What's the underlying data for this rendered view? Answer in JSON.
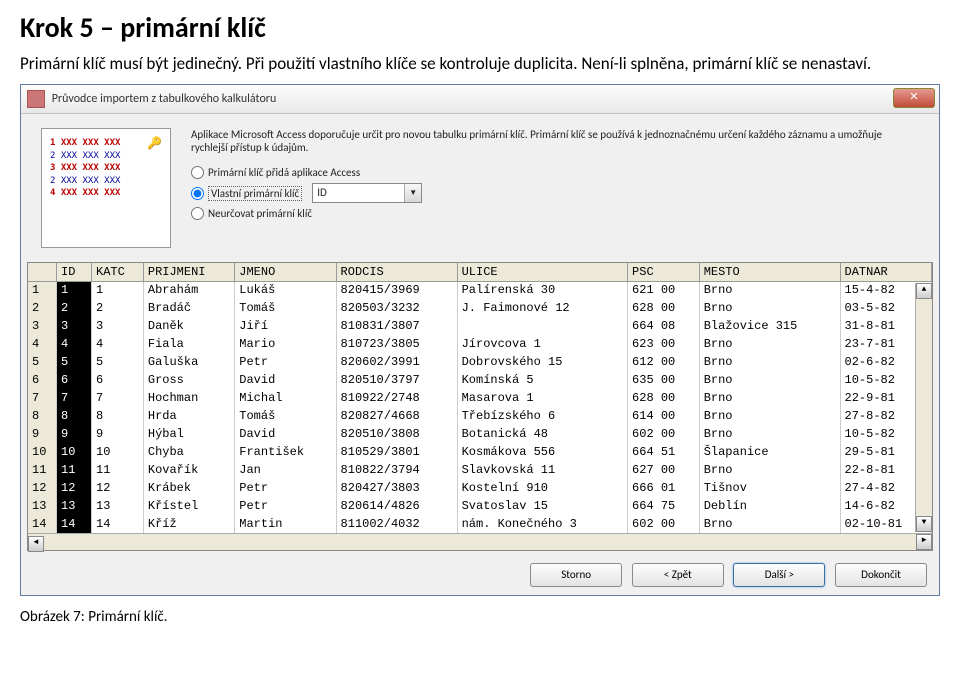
{
  "heading": "Krok 5 – primární klíč",
  "intro": "Primární klíč musí být jedinečný. Při použití vlastního klíče se kontroluje duplicita. Není-li splněna, primární klíč se nenastaví.",
  "caption": "Obrázek 7: Primární klíč.",
  "window": {
    "title": "Průvodce importem z tabulkového kalkulátoru",
    "close": "✕",
    "description": "Aplikace Microsoft Access doporučuje určit pro novou tabulku primární klíč. Primární klíč se používá k jednoznačnému určení každého záznamu a umožňuje rychlejší přístup k údajům.",
    "radios": {
      "r1": "Primární klíč přidá aplikace Access",
      "r2": "Vlastní primární klíč",
      "r3": "Neurčovat primární klíč"
    },
    "combo": {
      "value": "ID"
    },
    "illus": {
      "key": "🔑",
      "l1": "1  XXX XXX XXX",
      "l2": "2  XXX XXX XXX",
      "l3": "3  XXX XXX XXX",
      "l4": "2  XXX XXX XXX",
      "l5": "4  XXX XXX XXX"
    },
    "buttons": {
      "cancel": "Storno",
      "back": "< Zpět",
      "next": "Další >",
      "finish": "Dokončit"
    }
  },
  "grid": {
    "headers": [
      "ID",
      "KATC",
      "PRIJMENI",
      "JMENO",
      "RODCIS",
      "ULICE",
      "PSC",
      "MESTO",
      "DATNAR"
    ],
    "rows": [
      [
        "1",
        "1",
        "Abrahám",
        "Lukáš",
        "820415/3969",
        "Palírenská 30",
        "621 00",
        "Brno",
        "15-4-82"
      ],
      [
        "2",
        "2",
        "Bradáč",
        "Tomáš",
        "820503/3232",
        "J. Faimonové 12",
        "628 00",
        "Brno",
        "03-5-82"
      ],
      [
        "3",
        "3",
        "Daněk",
        "Jiří",
        "810831/3807",
        "",
        "664 08",
        "Blažovice 315",
        "31-8-81"
      ],
      [
        "4",
        "4",
        "Fiala",
        "Mario",
        "810723/3805",
        "Jírovcova 1",
        "623 00",
        "Brno",
        "23-7-81"
      ],
      [
        "5",
        "5",
        "Galuška",
        "Petr",
        "820602/3991",
        "Dobrovského 15",
        "612 00",
        "Brno",
        "02-6-82"
      ],
      [
        "6",
        "6",
        "Gross",
        "David",
        "820510/3797",
        "Komínská 5",
        "635 00",
        "Brno",
        "10-5-82"
      ],
      [
        "7",
        "7",
        "Hochman",
        "Michal",
        "810922/2748",
        "Masarova 1",
        "628 00",
        "Brno",
        "22-9-81"
      ],
      [
        "8",
        "8",
        "Hrda",
        "Tomáš",
        "820827/4668",
        "Třebízského 6",
        "614 00",
        "Brno",
        "27-8-82"
      ],
      [
        "9",
        "9",
        "Hýbal",
        "David",
        "820510/3808",
        "Botanická 48",
        "602 00",
        "Brno",
        "10-5-82"
      ],
      [
        "10",
        "10",
        "Chyba",
        "František",
        "810529/3801",
        "Kosmákova 556",
        "664 51",
        "Šlapanice",
        "29-5-81"
      ],
      [
        "11",
        "11",
        "Kovařík",
        "Jan",
        "810822/3794",
        "Slavkovská 11",
        "627 00",
        "Brno",
        "22-8-81"
      ],
      [
        "12",
        "12",
        "Krábek",
        "Petr",
        "820427/3803",
        "Kostelní 910",
        "666 01",
        "Tišnov",
        "27-4-82"
      ],
      [
        "13",
        "13",
        "Křístel",
        "Petr",
        "820614/4826",
        "Svatoslav 15",
        "664 75",
        "Deblín",
        "14-6-82"
      ],
      [
        "14",
        "14",
        "Kříž",
        "Martin",
        "811002/4032",
        "nám. Konečného 3",
        "602 00",
        "Brno",
        "02-10-81"
      ]
    ]
  }
}
